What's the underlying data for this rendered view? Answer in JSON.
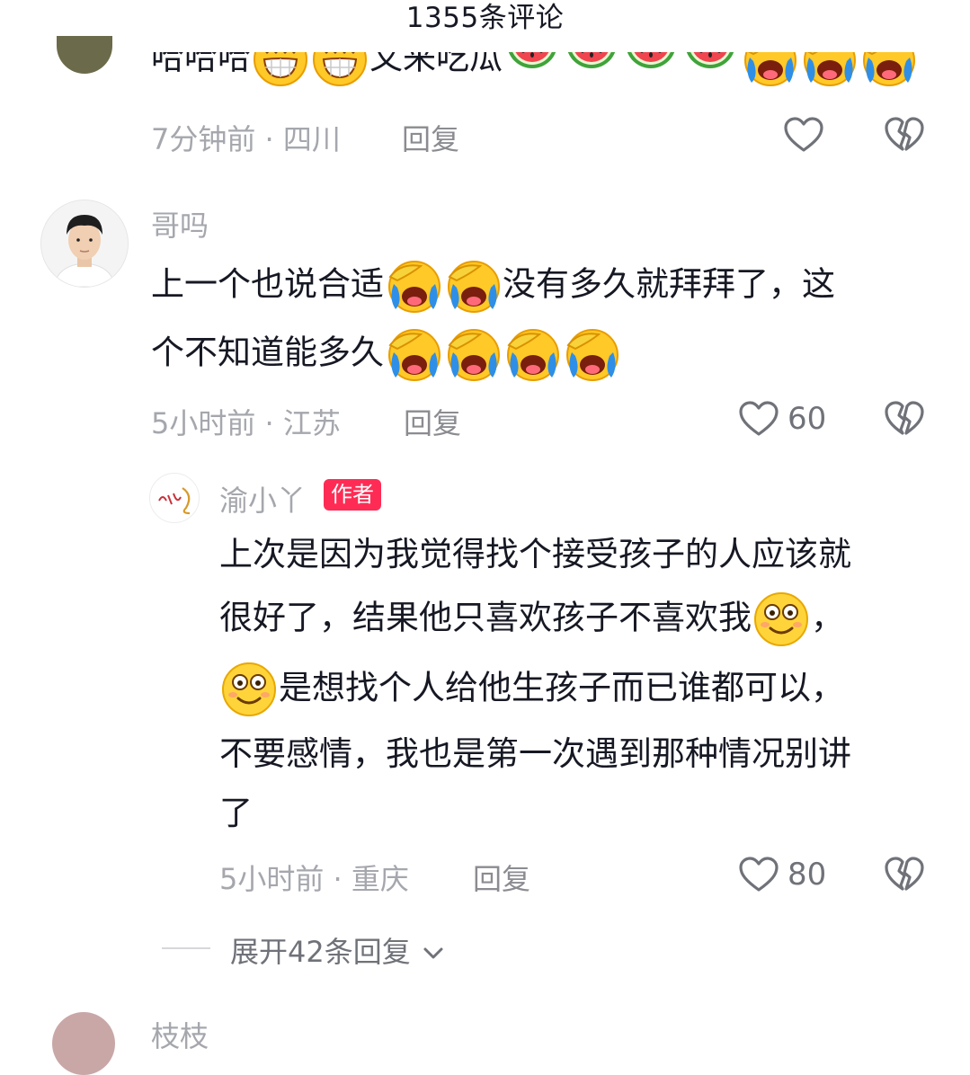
{
  "header": {
    "title": "1355条评论"
  },
  "comment0": {
    "text_prefix": "哈哈哈",
    "text_middle": "又来吃瓜",
    "time": "7分钟前",
    "location": "四川",
    "reply_label": "回复",
    "like_icon": "heart-outline-icon",
    "dislike_icon": "broken-heart-icon"
  },
  "comment1": {
    "username": "哥吗",
    "line1_a": "上一个也说合适",
    "line1_b": "没有多久就拜拜了，这",
    "line2_a": "个不知道能多久",
    "time": "5小时前",
    "location": "江苏",
    "reply_label": "回复",
    "like_count": "60"
  },
  "reply1": {
    "username": "渝小丫",
    "badge": "作者",
    "line1": "上次是因为我觉得找个接受孩子的人应该就",
    "line2_a": "很好了，结果他只喜欢孩子不喜欢我",
    "line2_b": "，",
    "line3_b": "是想找个人给他生孩子而已谁都可以，",
    "line4": "不要感情，我也是第一次遇到那种情况别讲",
    "line5": "了",
    "time": "5小时前",
    "location": "重庆",
    "reply_label": "回复",
    "like_count": "80"
  },
  "expand": {
    "label": "展开42条回复"
  },
  "next": {
    "username": "枝枝"
  },
  "colors": {
    "accent_badge": "#fe2c55",
    "text_primary": "#161823",
    "text_meta": "#a5a7ad"
  },
  "separator": "·"
}
